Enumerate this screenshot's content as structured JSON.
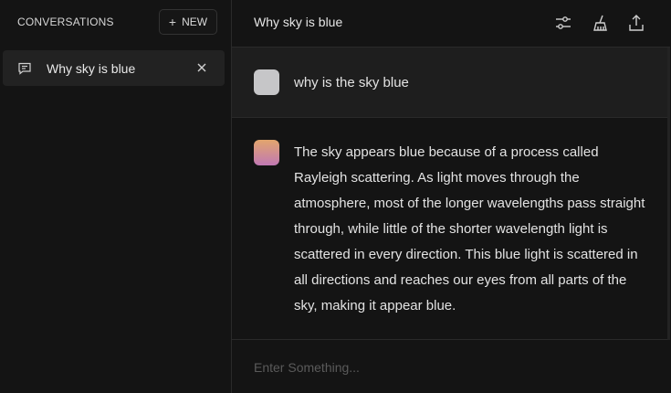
{
  "sidebar": {
    "title": "CONVERSATIONS",
    "new_button_label": "NEW",
    "conversations": [
      {
        "label": "Why sky is blue",
        "selected": true
      }
    ]
  },
  "header": {
    "title": "Why sky is blue",
    "icons": [
      "sliders-icon",
      "broom-icon",
      "share-icon"
    ]
  },
  "messages": [
    {
      "role": "user",
      "text": "why is the sky blue"
    },
    {
      "role": "assistant",
      "text": "The sky appears blue because of a process called Rayleigh scattering. As light moves through the atmosphere, most of the longer wavelengths pass straight through, while little of the shorter wavelength light is scattered in every direction. This blue light is scattered in all directions and reaches our eyes from all parts of the sky, making it appear blue."
    }
  ],
  "input": {
    "placeholder": "Enter Something...",
    "value": ""
  },
  "colors": {
    "background": "#141414",
    "selected_item": "#222222",
    "user_message_bg": "#1e1e1e",
    "user_avatar": "#c6c6c8",
    "bot_avatar_top": "#e2a56d",
    "bot_avatar_bottom": "#c179b4"
  }
}
